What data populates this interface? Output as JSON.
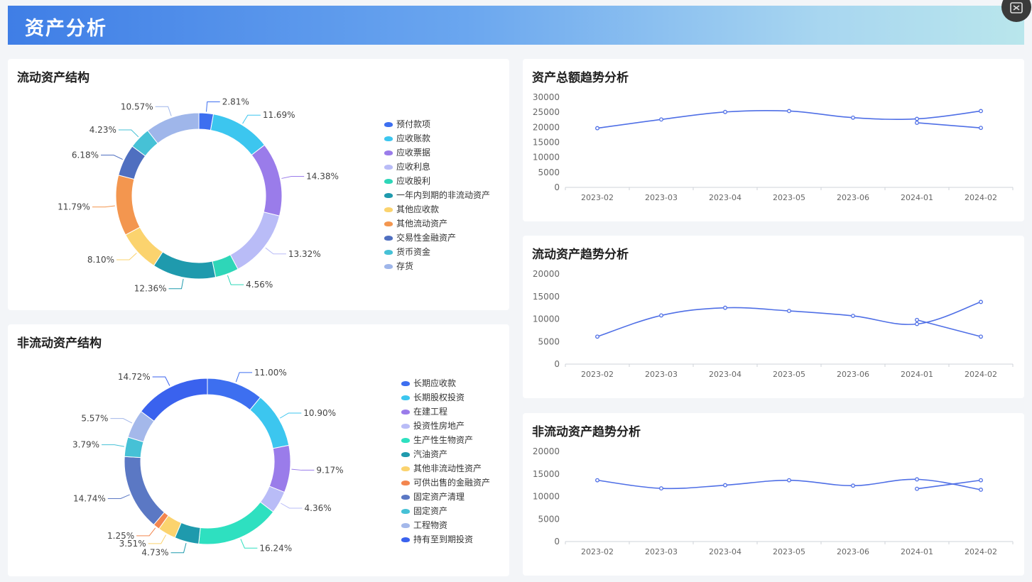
{
  "page": {
    "title": "资产分析"
  },
  "panels": {
    "current_structure": {
      "title": "流动资产结构"
    },
    "noncurrent_structure": {
      "title": "非流动资产结构"
    },
    "total_trend": {
      "title": "资产总额趋势分析"
    },
    "current_trend": {
      "title": "流动资产趋势分析"
    },
    "noncurrent_trend": {
      "title": "非流动资产趋势分析"
    }
  },
  "chart_data": [
    {
      "id": "current_structure",
      "type": "pie",
      "labels": [
        "预付款项",
        "应收账款",
        "应收票据",
        "应收利息",
        "应收股利",
        "一年内到期的非流动资产",
        "其他应收款",
        "其他流动资产",
        "交易性金融资产",
        "货币资金",
        "存货"
      ],
      "values": [
        2.81,
        11.69,
        14.38,
        13.32,
        4.56,
        12.36,
        8.1,
        11.79,
        6.18,
        4.23,
        10.57
      ],
      "value_labels": [
        "2.81%",
        "11.69%",
        "14.38%",
        "13.32%",
        "4.56%",
        "12.36%",
        "8.10%",
        "11.79%",
        "6.18%",
        "4.23%",
        "10.57%"
      ],
      "colors": [
        "#3d6ff0",
        "#3cc6ef",
        "#9a7cea",
        "#b9bcf7",
        "#2ed6b8",
        "#1f9aad",
        "#fbd36e",
        "#f3964f",
        "#4f6fc0",
        "#46c1d6",
        "#9fb6ea"
      ],
      "legend": "right"
    },
    {
      "id": "noncurrent_structure",
      "type": "pie",
      "labels": [
        "长期应收款",
        "长期股权投资",
        "在建工程",
        "投资性房地产",
        "生产性生物资产",
        "汽油资产",
        "其他非流动性资产",
        "可供出售的金融资产",
        "固定资产清理",
        "固定资产",
        "工程物资",
        "持有至到期投资"
      ],
      "values": [
        11.0,
        10.9,
        9.17,
        4.36,
        16.24,
        4.73,
        3.51,
        1.25,
        14.74,
        3.79,
        5.57,
        14.72
      ],
      "value_labels": [
        "11.00%",
        "10.90%",
        "9.17%",
        "4.36%",
        "16.24%",
        "4.73%",
        "3.51%",
        "1.25%",
        "14.74%",
        "3.79%",
        "5.57%",
        "14.72%"
      ],
      "colors": [
        "#3d6ff0",
        "#3cc6ef",
        "#9a7cea",
        "#b9bcf7",
        "#2ee0c0",
        "#1f9aad",
        "#fbd36e",
        "#f3864f",
        "#5b78c4",
        "#46c1d6",
        "#a4b8ea",
        "#3a62ee"
      ],
      "legend": "right"
    },
    {
      "id": "total_trend",
      "type": "line",
      "categories": [
        "2023-02",
        "2023-03",
        "2023-04",
        "2023-05",
        "2023-06",
        "2024-01",
        "2024-02"
      ],
      "series": [
        {
          "values": [
            19700,
            22600,
            25100,
            25400,
            23200,
            22800,
            25400
          ]
        },
        {
          "values": [
            null,
            null,
            null,
            null,
            null,
            21500,
            19800
          ]
        }
      ],
      "ylim": [
        0,
        30000
      ],
      "yticks": [
        0,
        5000,
        10000,
        15000,
        20000,
        25000,
        30000
      ],
      "color": "#4f6fe6",
      "grid": false
    },
    {
      "id": "current_trend",
      "type": "line",
      "categories": [
        "2023-02",
        "2023-03",
        "2023-04",
        "2023-05",
        "2023-06",
        "2024-01",
        "2024-02"
      ],
      "series": [
        {
          "values": [
            6100,
            10800,
            12500,
            11800,
            10700,
            8900,
            13800
          ]
        },
        {
          "values": [
            null,
            null,
            null,
            null,
            null,
            9800,
            6100
          ]
        }
      ],
      "ylim": [
        0,
        20000
      ],
      "yticks": [
        0,
        5000,
        10000,
        15000,
        20000
      ],
      "color": "#4f6fe6",
      "grid": false
    },
    {
      "id": "noncurrent_trend",
      "type": "line",
      "categories": [
        "2023-02",
        "2023-03",
        "2023-04",
        "2023-05",
        "2023-06",
        "2024-01",
        "2024-02"
      ],
      "series": [
        {
          "values": [
            13600,
            11800,
            12500,
            13600,
            12400,
            13800,
            11500
          ]
        },
        {
          "values": [
            null,
            null,
            null,
            null,
            null,
            11700,
            13600
          ]
        }
      ],
      "ylim": [
        0,
        20000
      ],
      "yticks": [
        0,
        5000,
        10000,
        15000,
        20000
      ],
      "color": "#4f6fe6",
      "grid": false
    }
  ]
}
